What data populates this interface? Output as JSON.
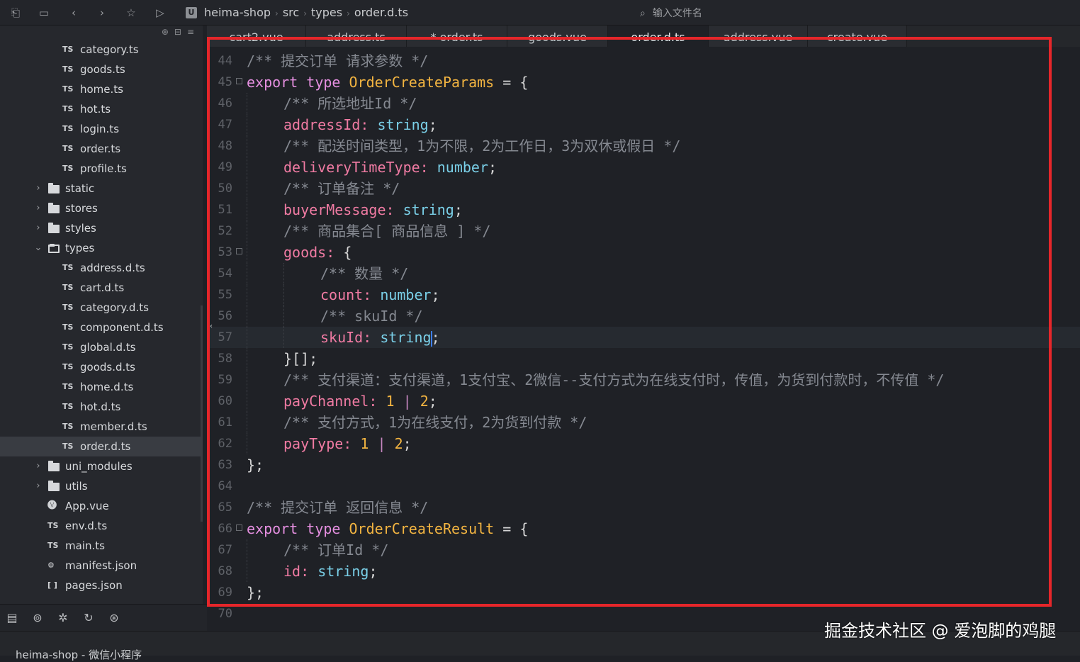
{
  "toolbar": {
    "icons": [
      "collapse-icon",
      "save-icon",
      "back-icon",
      "forward-icon",
      "star-icon",
      "run-icon"
    ],
    "project_badge": "U",
    "breadcrumb": [
      "heima-shop",
      "src",
      "types",
      "order.d.ts"
    ],
    "file_search_placeholder": "输入文件名"
  },
  "sidebar": {
    "tools": [
      "⊕",
      "⊟",
      "≡"
    ],
    "items": [
      {
        "label": "category.ts",
        "kind": "ts",
        "depth": 2
      },
      {
        "label": "goods.ts",
        "kind": "ts",
        "depth": 2
      },
      {
        "label": "home.ts",
        "kind": "ts",
        "depth": 2
      },
      {
        "label": "hot.ts",
        "kind": "ts",
        "depth": 2
      },
      {
        "label": "login.ts",
        "kind": "ts",
        "depth": 2
      },
      {
        "label": "order.ts",
        "kind": "ts",
        "depth": 2
      },
      {
        "label": "profile.ts",
        "kind": "ts",
        "depth": 2
      },
      {
        "label": "static",
        "kind": "folder",
        "depth": 1
      },
      {
        "label": "stores",
        "kind": "folder",
        "depth": 1
      },
      {
        "label": "styles",
        "kind": "folder",
        "depth": 1
      },
      {
        "label": "types",
        "kind": "folder-open",
        "depth": 1
      },
      {
        "label": "address.d.ts",
        "kind": "ts",
        "depth": 2
      },
      {
        "label": "cart.d.ts",
        "kind": "ts",
        "depth": 2
      },
      {
        "label": "category.d.ts",
        "kind": "ts",
        "depth": 2
      },
      {
        "label": "component.d.ts",
        "kind": "ts",
        "depth": 2
      },
      {
        "label": "global.d.ts",
        "kind": "ts",
        "depth": 2
      },
      {
        "label": "goods.d.ts",
        "kind": "ts",
        "depth": 2
      },
      {
        "label": "home.d.ts",
        "kind": "ts",
        "depth": 2
      },
      {
        "label": "hot.d.ts",
        "kind": "ts",
        "depth": 2
      },
      {
        "label": "member.d.ts",
        "kind": "ts",
        "depth": 2
      },
      {
        "label": "order.d.ts",
        "kind": "ts",
        "depth": 2,
        "selected": true
      },
      {
        "label": "uni_modules",
        "kind": "folder",
        "depth": 1
      },
      {
        "label": "utils",
        "kind": "folder",
        "depth": 1
      },
      {
        "label": "App.vue",
        "kind": "vue",
        "depth": 1
      },
      {
        "label": "env.d.ts",
        "kind": "ts",
        "depth": 1
      },
      {
        "label": "main.ts",
        "kind": "ts",
        "depth": 1
      },
      {
        "label": "manifest.json",
        "kind": "manifest",
        "depth": 1
      },
      {
        "label": "pages.json",
        "kind": "json",
        "depth": 1
      }
    ],
    "bottom_icons": [
      "explorer-icon",
      "search-icon",
      "debug-icon",
      "git-icon",
      "plugin-icon"
    ]
  },
  "tabs": [
    {
      "label": "cart2.vue"
    },
    {
      "label": "address.ts"
    },
    {
      "label": "* order.ts"
    },
    {
      "label": "goods.vue"
    },
    {
      "label": "order.d.ts",
      "active": true
    },
    {
      "label": "address.vue"
    },
    {
      "label": "create.vue"
    }
  ],
  "editor": {
    "lines": [
      {
        "n": "44",
        "indent": 0,
        "fold": false,
        "tokens": [
          [
            "cm",
            "/** 提交订单 请求参数 */"
          ]
        ]
      },
      {
        "n": "45",
        "indent": 0,
        "fold": true,
        "tokens": [
          [
            "kw",
            "export"
          ],
          [
            "pn",
            " "
          ],
          [
            "kw",
            "type"
          ],
          [
            "pn",
            " "
          ],
          [
            "tn",
            "OrderCreateParams"
          ],
          [
            "op",
            " = "
          ],
          [
            "pn",
            "{"
          ]
        ]
      },
      {
        "n": "46",
        "indent": 1,
        "fold": false,
        "tokens": [
          [
            "cm",
            "/** 所选地址Id */"
          ]
        ]
      },
      {
        "n": "47",
        "indent": 1,
        "fold": false,
        "tokens": [
          [
            "pr",
            "addressId"
          ],
          [
            "pr",
            ": "
          ],
          [
            "ty",
            "string"
          ],
          [
            "pn",
            ";"
          ]
        ]
      },
      {
        "n": "48",
        "indent": 1,
        "fold": false,
        "tokens": [
          [
            "cm",
            "/** 配送时间类型，1为不限，2为工作日，3为双休或假日 */"
          ]
        ]
      },
      {
        "n": "49",
        "indent": 1,
        "fold": false,
        "tokens": [
          [
            "pr",
            "deliveryTimeType"
          ],
          [
            "pr",
            ": "
          ],
          [
            "ty",
            "number"
          ],
          [
            "pn",
            ";"
          ]
        ]
      },
      {
        "n": "50",
        "indent": 1,
        "fold": false,
        "tokens": [
          [
            "cm",
            "/** 订单备注 */"
          ]
        ]
      },
      {
        "n": "51",
        "indent": 1,
        "fold": false,
        "tokens": [
          [
            "pr",
            "buyerMessage"
          ],
          [
            "pr",
            ": "
          ],
          [
            "ty",
            "string"
          ],
          [
            "pn",
            ";"
          ]
        ]
      },
      {
        "n": "52",
        "indent": 1,
        "fold": false,
        "tokens": [
          [
            "cm",
            "/** 商品集合[ 商品信息 ] */"
          ]
        ]
      },
      {
        "n": "53",
        "indent": 1,
        "fold": true,
        "tokens": [
          [
            "pr",
            "goods"
          ],
          [
            "pr",
            ": "
          ],
          [
            "pn",
            "{"
          ]
        ]
      },
      {
        "n": "54",
        "indent": 2,
        "fold": false,
        "tokens": [
          [
            "cm",
            "/** 数量 */"
          ]
        ]
      },
      {
        "n": "55",
        "indent": 2,
        "fold": false,
        "tokens": [
          [
            "pr",
            "count"
          ],
          [
            "pr",
            ": "
          ],
          [
            "ty",
            "number"
          ],
          [
            "pn",
            ";"
          ]
        ]
      },
      {
        "n": "56",
        "indent": 2,
        "fold": false,
        "tokens": [
          [
            "cm",
            "/** skuId */"
          ]
        ]
      },
      {
        "n": "57",
        "indent": 2,
        "fold": false,
        "current": true,
        "tokens": [
          [
            "pr",
            "skuId"
          ],
          [
            "pr",
            ": "
          ],
          [
            "ty",
            "string"
          ],
          [
            "caret",
            ""
          ],
          [
            "pn",
            ";"
          ]
        ]
      },
      {
        "n": "58",
        "indent": 1,
        "fold": false,
        "tokens": [
          [
            "pn",
            "}[];"
          ]
        ]
      },
      {
        "n": "59",
        "indent": 1,
        "fold": false,
        "tokens": [
          [
            "cm",
            "/** 支付渠道：支付渠道，1支付宝、2微信--支付方式为在线支付时，传值，为货到付款时，不传值 */"
          ]
        ]
      },
      {
        "n": "60",
        "indent": 1,
        "fold": false,
        "tokens": [
          [
            "pr",
            "payChannel"
          ],
          [
            "pr",
            ": "
          ],
          [
            "nm",
            "1"
          ],
          [
            "kw2",
            " | "
          ],
          [
            "nm",
            "2"
          ],
          [
            "pn",
            ";"
          ]
        ]
      },
      {
        "n": "61",
        "indent": 1,
        "fold": false,
        "tokens": [
          [
            "cm",
            "/** 支付方式，1为在线支付，2为货到付款 */"
          ]
        ]
      },
      {
        "n": "62",
        "indent": 1,
        "fold": false,
        "tokens": [
          [
            "pr",
            "payType"
          ],
          [
            "pr",
            ": "
          ],
          [
            "nm",
            "1"
          ],
          [
            "kw2",
            " | "
          ],
          [
            "nm",
            "2"
          ],
          [
            "pn",
            ";"
          ]
        ]
      },
      {
        "n": "63",
        "indent": 0,
        "fold": false,
        "tokens": [
          [
            "pn",
            "};"
          ]
        ]
      },
      {
        "n": "64",
        "indent": 0,
        "fold": false,
        "tokens": []
      },
      {
        "n": "65",
        "indent": 0,
        "fold": false,
        "tokens": [
          [
            "cm",
            "/** 提交订单 返回信息 */"
          ]
        ]
      },
      {
        "n": "66",
        "indent": 0,
        "fold": true,
        "tokens": [
          [
            "kw",
            "export"
          ],
          [
            "pn",
            " "
          ],
          [
            "kw",
            "type"
          ],
          [
            "pn",
            " "
          ],
          [
            "tn",
            "OrderCreateResult"
          ],
          [
            "op",
            " = "
          ],
          [
            "pn",
            "{"
          ]
        ]
      },
      {
        "n": "67",
        "indent": 1,
        "fold": false,
        "tokens": [
          [
            "cm",
            "/** 订单Id */"
          ]
        ]
      },
      {
        "n": "68",
        "indent": 1,
        "fold": false,
        "tokens": [
          [
            "pr",
            "id"
          ],
          [
            "pr",
            ": "
          ],
          [
            "ty",
            "string"
          ],
          [
            "pn",
            ";"
          ]
        ]
      },
      {
        "n": "69",
        "indent": 0,
        "fold": false,
        "tokens": [
          [
            "pn",
            "};"
          ]
        ]
      },
      {
        "n": "70",
        "indent": 0,
        "fold": false,
        "tokens": []
      }
    ]
  },
  "status": {
    "project_text": "heima-shop - 微信小程序"
  },
  "watermark": "掘金技术社区 @ 爱泡脚的鸡腿",
  "colors": {
    "highlight_border": "#e5262a",
    "background": "#1f2126"
  }
}
